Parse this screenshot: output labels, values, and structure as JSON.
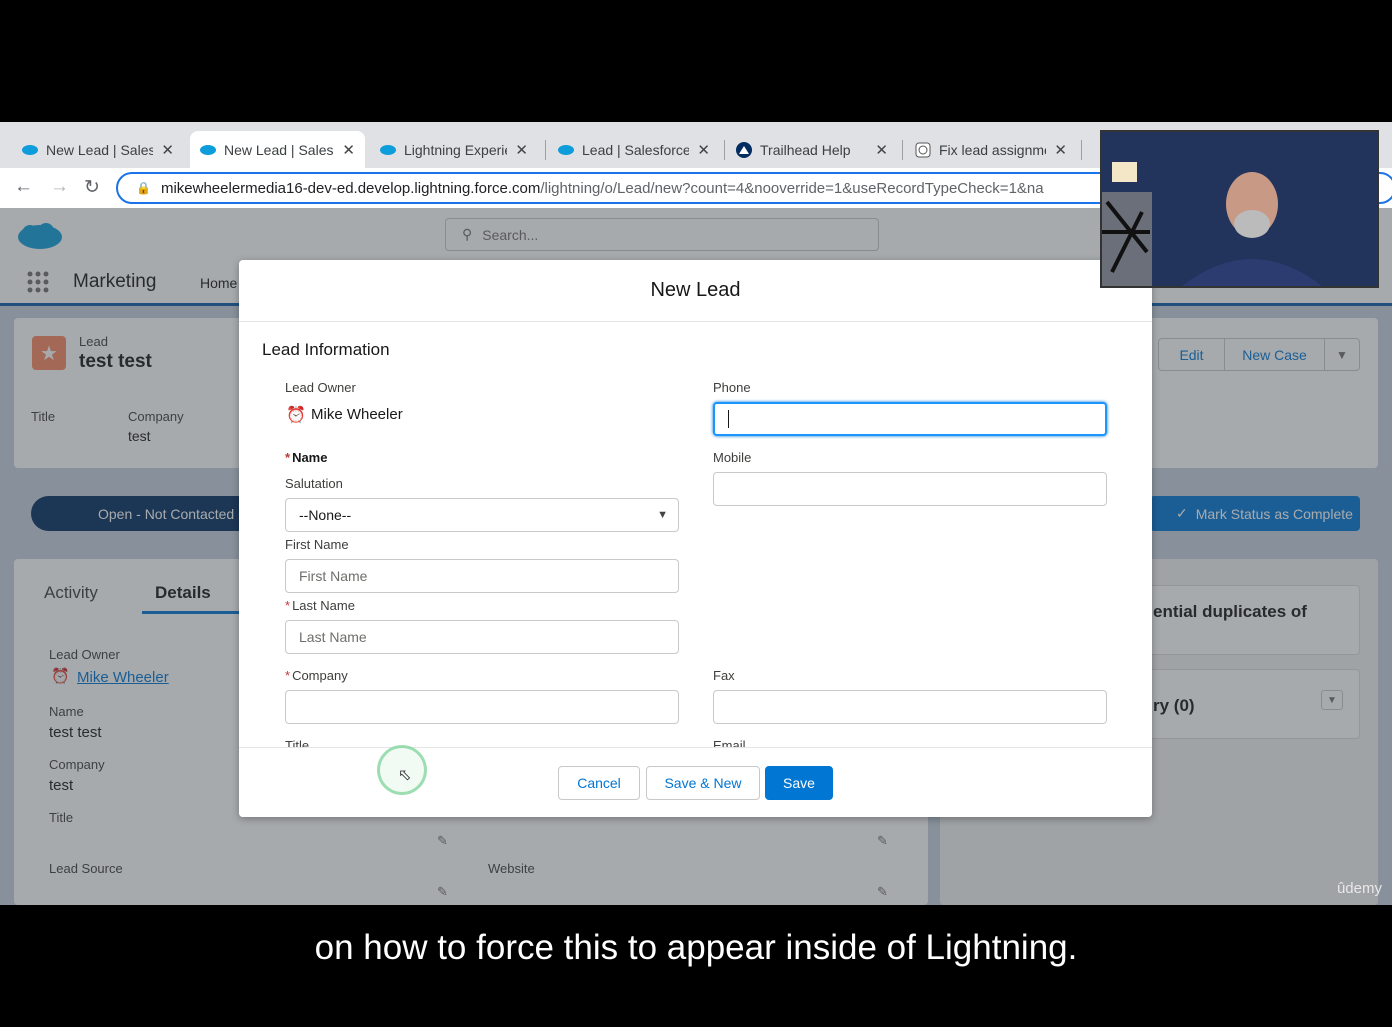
{
  "browser": {
    "tabs": [
      {
        "label": "New Lead | Salesf",
        "icon": "salesforce-cloud-icon"
      },
      {
        "label": "New Lead | Sales",
        "icon": "salesforce-cloud-icon"
      },
      {
        "label": "Lightning Experie",
        "icon": "salesforce-cloud-icon"
      },
      {
        "label": "Lead | Salesforce",
        "icon": "salesforce-cloud-icon"
      },
      {
        "label": "Trailhead Help",
        "icon": "trailhead-icon"
      },
      {
        "label": "Fix lead assignme",
        "icon": "chatgpt-icon"
      }
    ],
    "url_host": "mikewheelermedia16-dev-ed.develop.lightning.force.com",
    "url_path": "/lightning/o/Lead/new?count=4&nooverride=1&useRecordTypeCheck=1&na"
  },
  "sf": {
    "app_name": "Marketing",
    "nav_home": "Home",
    "search_placeholder": "Search...",
    "record_type": "Lead",
    "record_name": "test test",
    "highlights": {
      "title_label": "Title",
      "company_label": "Company",
      "company_value": "test"
    },
    "actions": {
      "edit": "Edit",
      "new_case": "New Case"
    },
    "path_stage": "Open - Not Contacted",
    "mark_complete": "Mark Status as Complete",
    "tabs": {
      "activity": "Activity",
      "details": "Details"
    },
    "details": {
      "lead_owner_label": "Lead Owner",
      "lead_owner_value": "Mike Wheeler",
      "name_label": "Name",
      "name_value": "test test",
      "company_label": "Company",
      "company_value": "test",
      "title_label": "Title",
      "lead_source_label": "Lead Source",
      "website_label": "Website"
    },
    "right": {
      "duplicates": "ential duplicates of",
      "history": "ry (0)"
    }
  },
  "modal": {
    "title": "New Lead",
    "section": "Lead Information",
    "lead_owner_label": "Lead Owner",
    "lead_owner_value": "Mike Wheeler",
    "phone_label": "Phone",
    "name_label": "Name",
    "mobile_label": "Mobile",
    "salutation_label": "Salutation",
    "salutation_value": "--None--",
    "first_name_label": "First Name",
    "first_name_placeholder": "First Name",
    "last_name_label": "Last Name",
    "last_name_placeholder": "Last Name",
    "company_label": "Company",
    "fax_label": "Fax",
    "title_label": "Title",
    "email_label": "Email",
    "cancel": "Cancel",
    "save_new": "Save & New",
    "save": "Save"
  },
  "overlay": {
    "caption": "on how to force this to appear inside of Lightning.",
    "watermark": "ûdemy"
  },
  "colors": {
    "brand": "#0176d3",
    "nav_blue": "#0b5cab",
    "path_blue": "#032d60",
    "required": "#c23934"
  }
}
